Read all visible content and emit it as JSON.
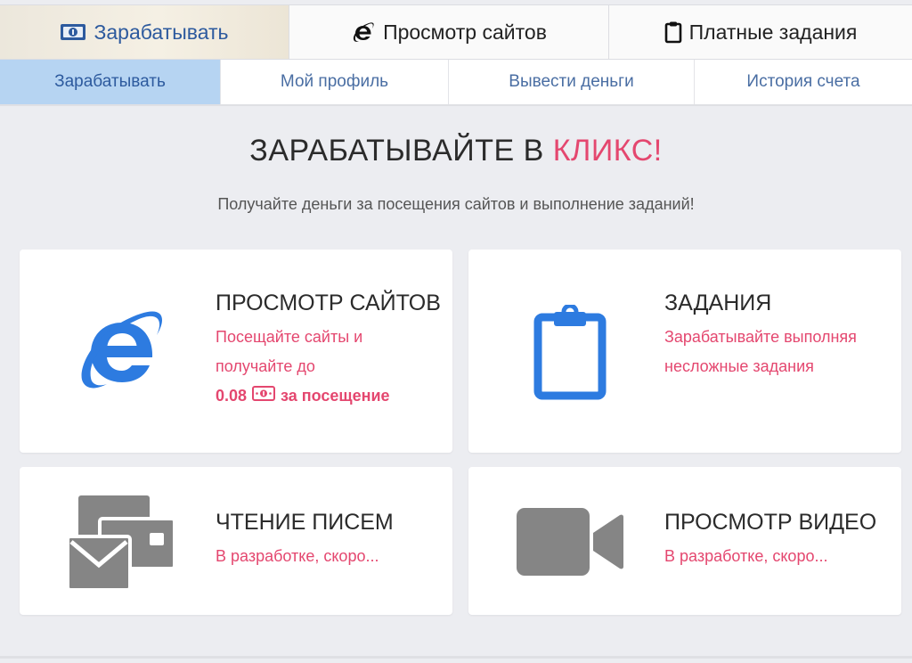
{
  "top_tabs": [
    {
      "label": "Зарабатывать",
      "icon": "money-icon"
    },
    {
      "label": "Просмотр сайтов",
      "icon": "internet-explorer-icon"
    },
    {
      "label": "Платные задания",
      "icon": "clipboard-icon"
    }
  ],
  "sub_tabs": [
    {
      "label": "Зарабатывать",
      "active": true
    },
    {
      "label": "Мой профиль"
    },
    {
      "label": "Вывести деньги"
    },
    {
      "label": "История счета"
    }
  ],
  "hero": {
    "title_main": "ЗАРАБАТЫВАЙТЕ В ",
    "title_accent": "КЛИКС!",
    "subtitle": "Получайте деньги за посещения сайтов и выполнение заданий!"
  },
  "cards": [
    {
      "title": "ПРОСМОТР САЙТОВ",
      "text": "Посещайте сайты и получайте до",
      "reward_value": "0.08",
      "reward_suffix": "за посещение",
      "icon": "internet-explorer-icon"
    },
    {
      "title": "ЗАДАНИЯ",
      "text": "Зарабатывайте выполняя несложные задания",
      "icon": "clipboard-icon"
    },
    {
      "title": "ЧТЕНИЕ ПИСЕМ",
      "text": "В разработке, скоро...",
      "icon": "mail-icon"
    },
    {
      "title": "ПРОСМОТР ВИДЕО",
      "text": "В разработке, скоро...",
      "icon": "video-camera-icon"
    }
  ],
  "colors": {
    "accent": "#e4476f",
    "brand_blue": "#2d7be0",
    "active_subtab": "#b6d4f2",
    "icon_gray": "#858585"
  }
}
